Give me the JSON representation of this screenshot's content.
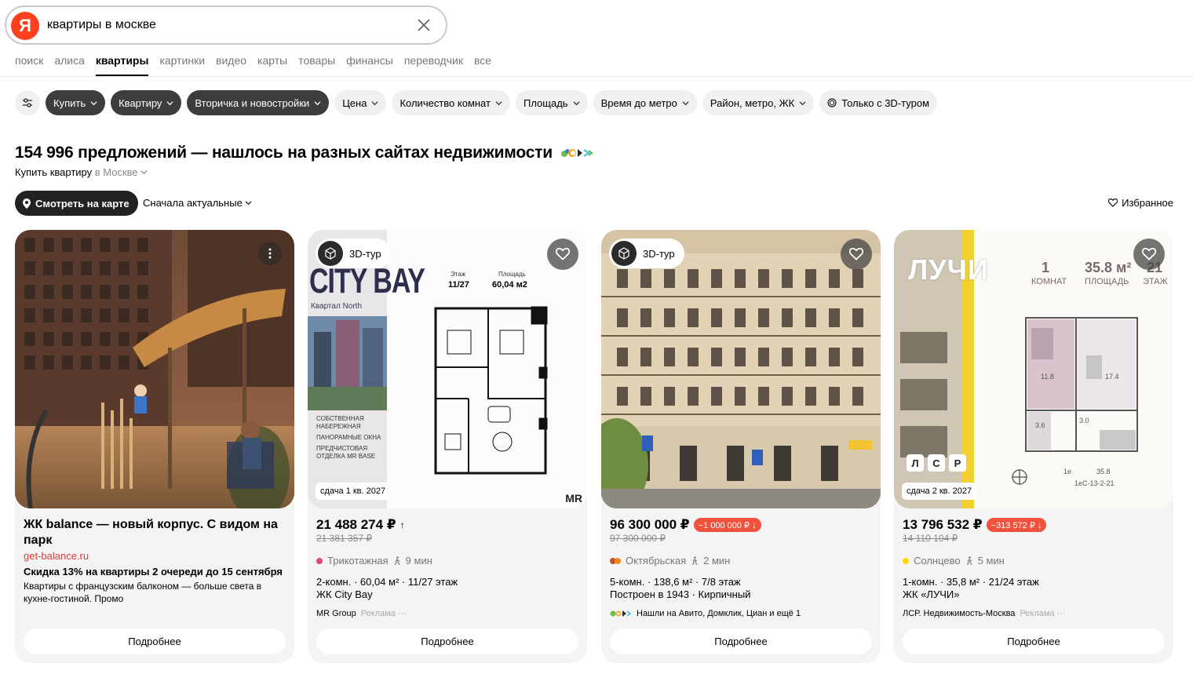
{
  "search": {
    "logo": "Я",
    "query": "квартиры в москве"
  },
  "nav": {
    "tabs": [
      "поиск",
      "алиса",
      "квартиры",
      "картинки",
      "видео",
      "карты",
      "товары",
      "финансы",
      "переводчик",
      "все"
    ],
    "active": "квартиры"
  },
  "filters": {
    "buy": "Купить",
    "type": "Квартиру",
    "market": "Вторичка и новостройки",
    "price": "Цена",
    "rooms": "Количество комнат",
    "area": "Площадь",
    "metro_time": "Время до метро",
    "district": "Район, метро, ЖК",
    "tour_3d": "Только с 3D-туром"
  },
  "results": {
    "title": "154 996 предложений — нашлось на разных сайтах недвижимости",
    "subtitle_main": "Купить квартиру",
    "subtitle_city": "в Москве",
    "map_button": "Смотреть на карте",
    "sort": "Сначала актуальные",
    "favorites": "Избранное"
  },
  "cards": {
    "ad": {
      "title": "ЖК balance — новый корпус. С видом на парк",
      "domain": "get-balance.ru",
      "promo": "Скидка 13% на квартиры 2 очереди до 15 сентября",
      "text": "Квартиры с французским балконом — больше света в кухне-гостиной. Промо",
      "button": "Подробнее"
    },
    "c1": {
      "badge": "3D-тур",
      "date": "сдача 1 кв. 2027",
      "brand": "CITY BAY",
      "brand_sub": "Квартал North",
      "plan_floor_label": "Этаж",
      "plan_floor": "11/27",
      "plan_area_label": "Площадь",
      "plan_area": "60,04 м2",
      "features": [
        "СОБСТВЕННАЯ НАБЕРЕЖНАЯ",
        "ПАНОРАМНЫЕ ОКНА",
        "ПРЕДЧИСТОВАЯ ОТДЕЛКА MR BASE"
      ],
      "watermark": "MR",
      "price": "21 488 274 ₽",
      "price_arrow": "↑",
      "old_price": "21 381 357 ₽",
      "metro": "Трикотажная",
      "metro_color": "#e0457b",
      "walk": "9 мин",
      "info1": "2-комн. · 60,04 м² · 11/27 этаж",
      "info2": "ЖК City Bay",
      "seller": "MR Group",
      "ad_label": "Реклама ···",
      "button": "Подробнее"
    },
    "c2": {
      "badge": "3D-тур",
      "price": "96 300 000 ₽",
      "drop": "−1 000 000 ₽ ↓",
      "old_price": "97 300 000 ₽",
      "metro": "Октябрьская",
      "metro_color": "#b8562a",
      "metro_color2": "#f08a1c",
      "walk": "2 мин",
      "info1": "5-комн. · 138,6 м² · 7/8 этаж",
      "info2": "Построен в 1943 · Кирпичный",
      "sources": "Нашли на Авито, Домклик, Циан и ещё 1",
      "button": "Подробнее"
    },
    "c3": {
      "date": "сдача 2 кв. 2027",
      "brand": "ЛУЧИ",
      "plan_rooms": "1",
      "plan_rooms_label": "КОМНАТ",
      "plan_area": "35.8 м²",
      "plan_area_label": "ПЛОЩАДЬ",
      "plan_floor": "21",
      "plan_floor_label": "ЭТАЖ",
      "plan_room1": "11.8",
      "plan_room2": "17.4",
      "plan_room3": "3.6",
      "plan_room4": "3.0",
      "plan_code1": "1е",
      "plan_code2": "35.8",
      "plan_code3": "1еС-13-2-21",
      "developer_logo": [
        "Л",
        "С",
        "Р"
      ],
      "price": "13 796 532 ₽",
      "drop": "−313 572 ₽ ↓",
      "old_price": "14 110 104 ₽",
      "metro": "Солнцево",
      "metro_color": "#ffd800",
      "walk": "5 мин",
      "info1": "1-комн. · 35,8 м² · 21/24 этаж",
      "info2": "ЖК «ЛУЧИ»",
      "seller": "ЛСР. Недвижимость-Москва",
      "ad_label": "Реклама ···",
      "button": "Подробнее"
    }
  },
  "colors": {
    "brand_red": "#fc3f1d",
    "chip_dark": "#3d3d3d",
    "drop_badge": "#f0523d",
    "domain_red": "#e23a3a"
  }
}
